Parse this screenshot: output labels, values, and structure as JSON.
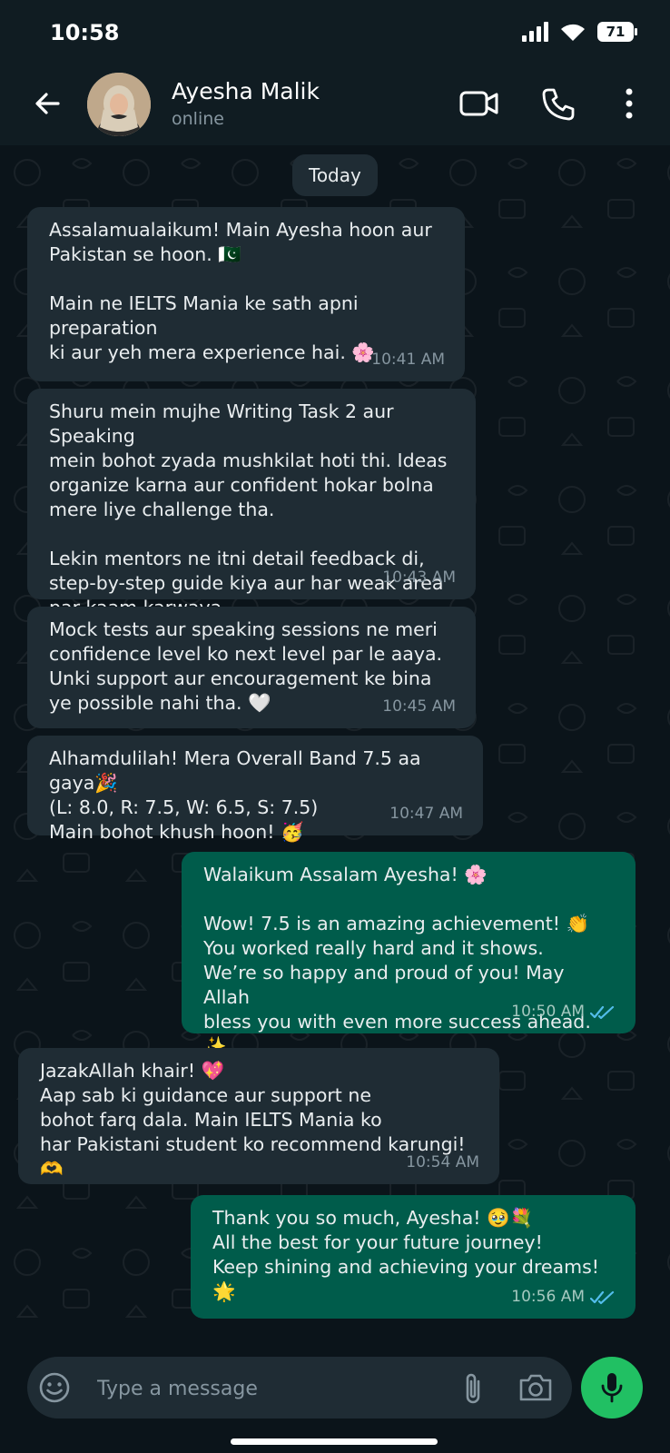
{
  "status_bar": {
    "time": "10:58",
    "battery": "71"
  },
  "header": {
    "contact_name": "Ayesha Malik",
    "contact_status": "online"
  },
  "chat": {
    "date_divider": "Today",
    "messages": [
      {
        "direction": "in",
        "text": "Assalamualaikum! Main Ayesha hoon aur\nPakistan se hoon. 🇵🇰\n\nMain ne IELTS Mania ke sath apni preparation\nki aur yeh mera experience hai. 🌸",
        "time": "10:41 AM"
      },
      {
        "direction": "in",
        "text": "Shuru mein mujhe Writing Task 2 aur Speaking\nmein bohot zyada mushkilat hoti thi. Ideas\norganize karna aur confident hokar bolna\nmere liye challenge tha.\n\nLekin mentors ne itni detail feedback di,\nstep-by-step guide kiya aur har weak area\npar kaam karwaya.",
        "time": "10:43 AM"
      },
      {
        "direction": "in",
        "text": "Mock tests aur speaking sessions ne meri\nconfidence level ko next level par le aaya.\nUnki support aur encouragement ke bina\nye possible nahi tha. 🤍",
        "time": "10:45 AM"
      },
      {
        "direction": "in",
        "text": "Alhamdulilah! Mera Overall Band 7.5 aa gaya🎉\n(L: 8.0, R: 7.5, W: 6.5, S: 7.5)\nMain bohot khush hoon! 🥳",
        "time": "10:47 AM"
      },
      {
        "direction": "out",
        "text": "Walaikum Assalam Ayesha! 🌸\n\nWow! 7.5 is an amazing achievement! 👏\nYou worked really hard and it shows.\nWe’re so happy and proud of you! May Allah\nbless you with even more success ahead. ✨",
        "time": "10:50 AM"
      },
      {
        "direction": "in",
        "text": "JazakAllah khair! 💖\nAap sab ki guidance aur support ne\nbohot farq dala. Main IELTS Mania ko\nhar Pakistani student ko recommend karungi! 🫶",
        "time": "10:54 AM"
      },
      {
        "direction": "out",
        "text": "Thank you so much, Ayesha! 🥹💐\nAll the best for your future journey!\nKeep shining and achieving your dreams! 🌟",
        "time": "10:56 AM"
      }
    ]
  },
  "composer": {
    "placeholder": "Type a message"
  },
  "colors": {
    "background": "#0b141a",
    "incoming_bubble": "#1f2c34",
    "outgoing_bubble": "#005c4b",
    "accent_green": "#21c063",
    "read_tick": "#53bdeb"
  },
  "icons": [
    "back-arrow-icon",
    "video-call-icon",
    "voice-call-icon",
    "more-options-icon",
    "emoji-icon",
    "attach-icon",
    "camera-icon",
    "mic-icon",
    "double-check-icon"
  ]
}
